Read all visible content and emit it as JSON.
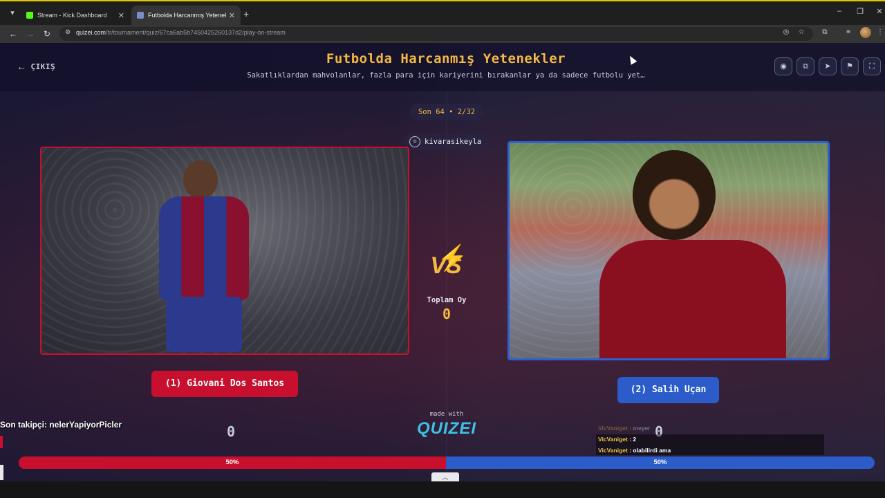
{
  "browser": {
    "tabs": [
      {
        "title": "Stream - Kick Dashboard",
        "active": false,
        "favicon_color": "#53fc18"
      },
      {
        "title": "Futbolda Harcanmış Yetenekler",
        "active": true,
        "favicon_color": "#7a8cc8"
      }
    ],
    "url": {
      "host": "quizei.com",
      "path": "/tr/tournament/quiz/67ca6ab5b7450425260137d2/play-on-stream"
    }
  },
  "quiz": {
    "back_label": "ÇIKIŞ",
    "title": "Futbolda Harcanmış Yetenekler",
    "subtitle": "Sakatlıklardan mahvolanlar, fazla para için kariyerini bırakanlar ya da sadece futbolu yet…",
    "round": "Son 64 • 2/32",
    "username": "kivarasikeyla",
    "vs": "VS",
    "total_votes_label": "Toplam Oy",
    "total_votes": "0",
    "made_with": "made with",
    "brand": "QUIZEI"
  },
  "left_player": {
    "label": "(1) Giovani Dos Santos",
    "votes": "0",
    "percent": "50%",
    "color": "#c8102e"
  },
  "right_player": {
    "label": "(2) Salih Uçan",
    "votes": "0",
    "percent": "50%",
    "color": "#2b5cc9"
  },
  "overlay": {
    "follower": "Son takipçi: nelerYapiyorPicler",
    "chat": [
      {
        "user": "VicVaniget",
        "text": "meyer"
      },
      {
        "user": "VicVaniget",
        "text": "2"
      },
      {
        "user": "VicVaniget",
        "text": "olabilirdi ama"
      }
    ]
  },
  "accent": "#f4b942"
}
